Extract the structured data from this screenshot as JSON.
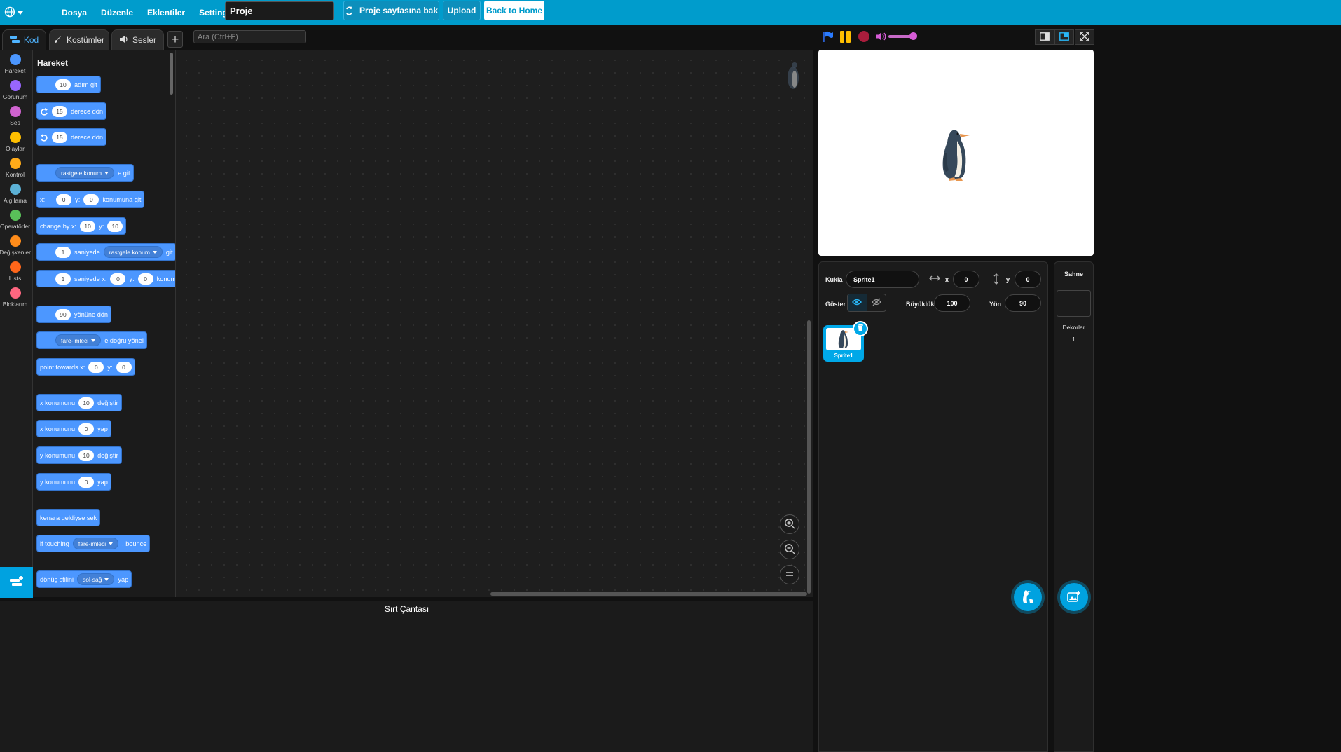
{
  "menu": {
    "file": "Dosya",
    "edit": "Düzenle",
    "addons": "Eklentiler",
    "settings": "Settings",
    "project_title": "Proje",
    "see_project_page": "Proje sayfasına bak",
    "upload": "Upload",
    "back_home": "Back to Home"
  },
  "tabs": {
    "code": "Kod",
    "costumes": "Kostümler",
    "sounds": "Sesler"
  },
  "search": {
    "placeholder": "Ara (Ctrl+F)"
  },
  "categories": [
    {
      "label": "Hareket",
      "color": "#4c97ff"
    },
    {
      "label": "Görünüm",
      "color": "#9966ff"
    },
    {
      "label": "Ses",
      "color": "#cf63cf"
    },
    {
      "label": "Olaylar",
      "color": "#ffbf00"
    },
    {
      "label": "Kontrol",
      "color": "#ffab19"
    },
    {
      "label": "Algılama",
      "color": "#5cb1d6"
    },
    {
      "label": "Operatörler",
      "color": "#59c059"
    },
    {
      "label": "Değişkenler",
      "color": "#ff8c1a"
    },
    {
      "label": "Lists",
      "color": "#ff661a"
    },
    {
      "label": "Bloklarım",
      "color": "#ff6680"
    }
  ],
  "palette": {
    "title": "Hareket",
    "move": {
      "value": "10",
      "text": "adım git"
    },
    "turn_right": {
      "value": "15",
      "text": "derece dön"
    },
    "turn_left": {
      "value": "15",
      "text": "derece dön"
    },
    "goto": {
      "dropdown": "rastgele konum",
      "text": "e git"
    },
    "goto_xy": {
      "x_label": "x:",
      "x": "0",
      "y_label": "y:",
      "y": "0",
      "text": "konumuna git"
    },
    "change_by": {
      "text": "change by x:",
      "x": "10",
      "y_label": "y:",
      "y": "10"
    },
    "glide": {
      "value": "1",
      "text1": "saniyede",
      "dropdown": "rastgele konum",
      "text2": "git"
    },
    "glide_xy": {
      "value": "1",
      "text1": "saniyede x:",
      "x": "0",
      "y_label": "y:",
      "y": "0",
      "text2": "konumu"
    },
    "point_dir": {
      "value": "90",
      "text": "yönüne dön"
    },
    "point_towards": {
      "dropdown": "fare-imleci",
      "text": "e doğru yönel"
    },
    "point_towards_xy": {
      "text": "point towards x:",
      "x": "0",
      "y_label": "y:",
      "y": "0"
    },
    "change_x": {
      "text1": "x konumunu",
      "value": "10",
      "text2": "değiştir"
    },
    "set_x": {
      "text1": "x konumunu",
      "value": "0",
      "text2": "yap"
    },
    "change_y": {
      "text1": "y konumunu",
      "value": "10",
      "text2": "değiştir"
    },
    "set_y": {
      "text1": "y konumunu",
      "value": "0",
      "text2": "yap"
    },
    "bounce": {
      "text": "kenara geldiyse sek"
    },
    "if_touching": {
      "text1": "if touching",
      "dropdown": "fare-imleci",
      "text2": ", bounce"
    },
    "rotation_style": {
      "text1": "dönüş stilini",
      "dropdown": "sol-sağ",
      "text2": "yap"
    }
  },
  "backpack": {
    "label": "Sırt Çantası"
  },
  "sprite_info": {
    "sprite_label": "Kukla",
    "sprite_name": "Sprite1",
    "x_label": "x",
    "x": "0",
    "y_label": "y",
    "y": "0",
    "show_label": "Göster",
    "size_label": "Büyüklük",
    "size": "100",
    "direction_label": "Yön",
    "direction": "90"
  },
  "sprites": [
    {
      "name": "Sprite1"
    }
  ],
  "stage_selector": {
    "title": "Sahne",
    "backdrops_label": "Dekorlar",
    "backdrops_count": "1"
  },
  "colors": {
    "menu_bar": "#009ccc",
    "motion": "#4c97ff",
    "accent": "#00a2e0"
  }
}
